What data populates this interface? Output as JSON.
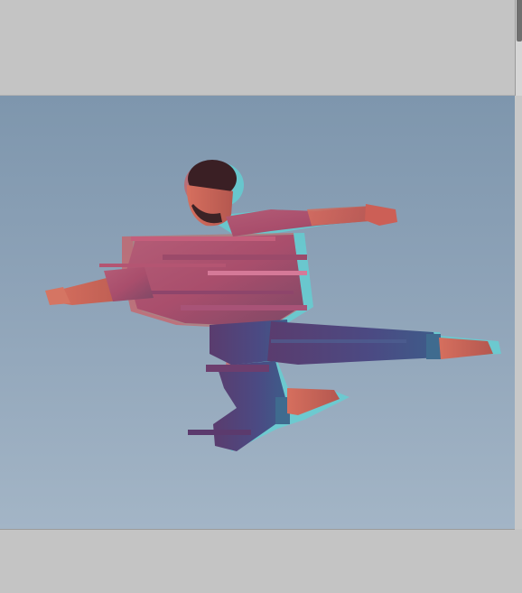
{
  "app": {
    "workspace_color": "#c4c4c4",
    "canvas_gradient": [
      "#7e96ad",
      "#8ea3b8",
      "#a3b5c6"
    ]
  },
  "canvas": {
    "subject": "dancer-glitch-effect-image"
  },
  "icons": {
    "scroll_thumb": "scrollbar-thumb"
  }
}
